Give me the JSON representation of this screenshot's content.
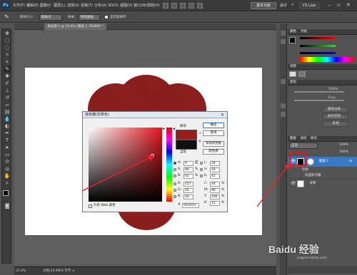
{
  "app": {
    "logo": "Ps"
  },
  "menu": [
    "文件(F)",
    "编辑(E)",
    "图像(I)",
    "图层(L)",
    "选择(S)",
    "滤镜(T)",
    "分析(A)",
    "3D(D)",
    "视图(V)",
    "窗口(W)",
    "帮助(H)"
  ],
  "header": {
    "workspace_label": "基本功能",
    "design_label": "设计",
    "cslive_label": "CS Live"
  },
  "options": {
    "size_label": "取样大小：",
    "size_value": "取样点",
    "sample_label": "样本：",
    "sample_value": "所有图层",
    "ring_label": "显示取样环"
  },
  "document": {
    "tab_title": "未标题-1 @ 24.4% (图层 1, RGB/8) *"
  },
  "status": {
    "zoom": "24.4%",
    "doc_info": "文档:24.9M/0 字节"
  },
  "dialog": {
    "title": "拾色器(前景色)",
    "new_label": "新的",
    "current_label": "当前",
    "new_color": "#9b1b1b",
    "current_color": "#101010",
    "ok": "确定",
    "cancel": "取消",
    "add_swatch": "添加到色板",
    "libraries": "颜色库",
    "web_only": "只有 Web 颜色",
    "fields": {
      "H": {
        "label": "H:",
        "value": "0",
        "unit": "度"
      },
      "S": {
        "label": "S:",
        "value": "90",
        "unit": "%"
      },
      "B": {
        "label": "B:",
        "value": "62",
        "unit": "%"
      },
      "R": {
        "label": "R:",
        "value": "157"
      },
      "G": {
        "label": "G:",
        "value": "16"
      },
      "Bl": {
        "label": "B:",
        "value": "16"
      },
      "L": {
        "label": "L:",
        "value": "34"
      },
      "a": {
        "label": "a:",
        "value": "54"
      },
      "b": {
        "label": "b:",
        "value": "42"
      },
      "C": {
        "label": "C:",
        "value": "44",
        "unit": "%"
      },
      "M": {
        "label": "M:",
        "value": "96",
        "unit": "%"
      },
      "Y": {
        "label": "Y:",
        "value": "100",
        "unit": "%"
      },
      "K": {
        "label": "K:",
        "value": "12",
        "unit": "%"
      },
      "hex": {
        "label": "#",
        "value": "9d1010"
      }
    }
  },
  "panels": {
    "color_tab": "颜色",
    "swatches_tab": "色板",
    "adjust_label": "调整",
    "mask_tabs": [
      "蒙版"
    ],
    "mask_buttons": [
      "蒙版边缘...",
      "颜色范围...",
      "反相"
    ],
    "mask_pct": [
      "100%",
      "0 px"
    ],
    "layers_tabs": [
      "图层",
      "通道",
      "路径"
    ],
    "blend_mode": "正常",
    "opacity": "100%",
    "fill": "100%",
    "layers": [
      {
        "name": "图层 1",
        "selected": true,
        "fx": true
      },
      {
        "name": "效果",
        "sub": true
      },
      {
        "name": "斜面和浮雕",
        "sub": true
      },
      {
        "name": "背景",
        "selected": false
      }
    ]
  },
  "watermark": {
    "text": "Baidu 经验",
    "url": "jingyan.baidu.com"
  }
}
